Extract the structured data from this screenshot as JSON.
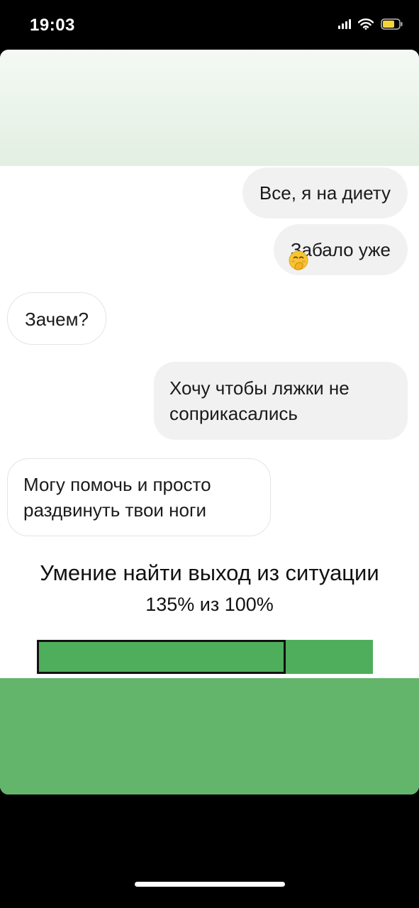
{
  "status_bar": {
    "time": "19:03",
    "icons": [
      "signal-icon",
      "wifi-icon",
      "battery-icon"
    ],
    "battery_color": "#f4d33a"
  },
  "chat": {
    "messages": [
      {
        "side": "outgoing",
        "text": "Все, я на диету"
      },
      {
        "side": "outgoing",
        "text": "За",
        "text_after_emoji": "бало уже",
        "emoji": "face-with-hand-over-mouth-icon"
      },
      {
        "side": "incoming",
        "text": "Зачем?"
      },
      {
        "side": "outgoing",
        "lines": [
          "Хочу чтобы ляжки не",
          "соприкасались"
        ]
      },
      {
        "side": "incoming",
        "lines": [
          "Могу помочь и просто",
          "раздвинуть твои ноги"
        ]
      }
    ]
  },
  "meme": {
    "title": "Умение найти выход из ситуации",
    "value_text": "135% из 100%",
    "progress_value": 1.35,
    "progress_max": 1.0,
    "bar_color": "#4fae5c",
    "band_color": "#63b56c"
  }
}
